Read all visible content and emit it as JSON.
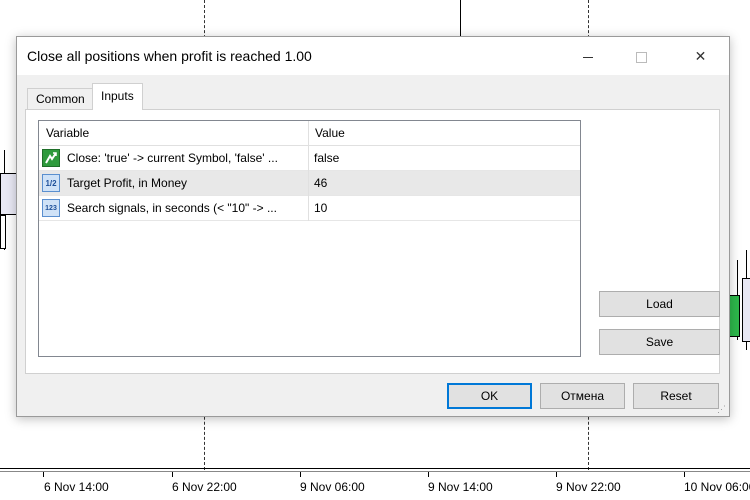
{
  "chart": {
    "x_labels": [
      "6 Nov 14:00",
      "6 Nov 22:00",
      "9 Nov 06:00",
      "9 Nov 14:00",
      "9 Nov 22:00",
      "10 Nov 06:00"
    ]
  },
  "dialog": {
    "title": "Close all positions when profit is reached 1.00",
    "tabs": [
      {
        "label": "Common",
        "active": false
      },
      {
        "label": "Inputs",
        "active": true
      }
    ],
    "table": {
      "columns": [
        "Variable",
        "Value"
      ],
      "rows": [
        {
          "icon": "bool-icon",
          "icon_text": "",
          "variable": "Close: 'true' -> current Symbol, 'false' ...",
          "value": "false",
          "selected": false
        },
        {
          "icon": "fraction-icon",
          "icon_text": "1/2",
          "variable": "Target Profit, in Money",
          "value": "46",
          "selected": true
        },
        {
          "icon": "integer-icon",
          "icon_text": "123",
          "variable": "Search signals, in seconds (< \"10\" -> ...",
          "value": "10",
          "selected": false
        }
      ]
    },
    "buttons": {
      "load": "Load",
      "save": "Save",
      "ok": "OK",
      "cancel": "Отмена",
      "reset": "Reset"
    }
  }
}
